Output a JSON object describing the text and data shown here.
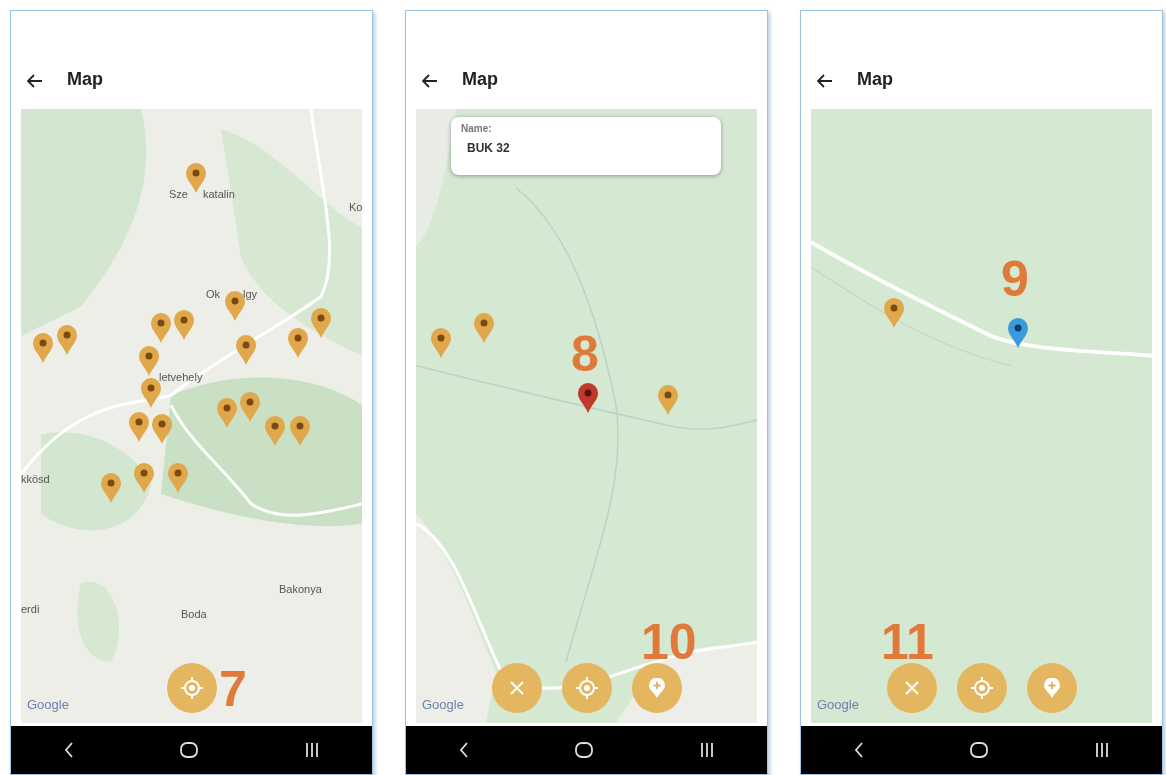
{
  "panels": [
    {
      "header": {
        "title": "Map"
      },
      "map": {
        "kind": "overview",
        "labels": [
          "Sze",
          "katalin",
          "Ko",
          "Ok",
          "lgy",
          "letvehely",
          "kkösd",
          "erdi",
          "Boda",
          "Bakonya"
        ],
        "markers": [
          {
            "color": "#e0a84a"
          },
          {
            "color": "#e0a84a"
          },
          {
            "color": "#e0a84a"
          },
          {
            "color": "#e0a84a"
          },
          {
            "color": "#e0a84a"
          },
          {
            "color": "#e0a84a"
          },
          {
            "color": "#e0a84a"
          },
          {
            "color": "#e0a84a"
          },
          {
            "color": "#e0a84a"
          },
          {
            "color": "#e0a84a"
          },
          {
            "color": "#e0a84a"
          },
          {
            "color": "#e0a84a"
          },
          {
            "color": "#e0a84a"
          },
          {
            "color": "#e0a84a"
          },
          {
            "color": "#e0a84a"
          },
          {
            "color": "#e0a84a"
          },
          {
            "color": "#e0a84a"
          },
          {
            "color": "#e0a84a"
          },
          {
            "color": "#e0a84a"
          },
          {
            "color": "#e0a84a"
          }
        ],
        "attribution": "Google",
        "callouts": [
          "7"
        ]
      },
      "buttons": [
        {
          "kind": "locate"
        }
      ]
    },
    {
      "header": {
        "title": "Map"
      },
      "map": {
        "kind": "forest",
        "markers": [
          {
            "color": "#e0a84a"
          },
          {
            "color": "#e0a84a"
          },
          {
            "color": "#e0a84a"
          },
          {
            "color": "#c0392b"
          }
        ],
        "info_card": {
          "label": "Name:",
          "value": "BUK 32"
        },
        "attribution": "Google",
        "callouts": [
          "8",
          "10"
        ]
      },
      "buttons": [
        {
          "kind": "close"
        },
        {
          "kind": "locate"
        },
        {
          "kind": "add_pin"
        }
      ]
    },
    {
      "header": {
        "title": "Map"
      },
      "map": {
        "kind": "road",
        "markers": [
          {
            "color": "#e0a84a"
          },
          {
            "color": "#3b9ad9"
          }
        ],
        "attribution": "Google",
        "callouts": [
          "9",
          "11"
        ]
      },
      "buttons": [
        {
          "kind": "close"
        },
        {
          "kind": "locate"
        },
        {
          "kind": "add_pin"
        }
      ]
    }
  ]
}
